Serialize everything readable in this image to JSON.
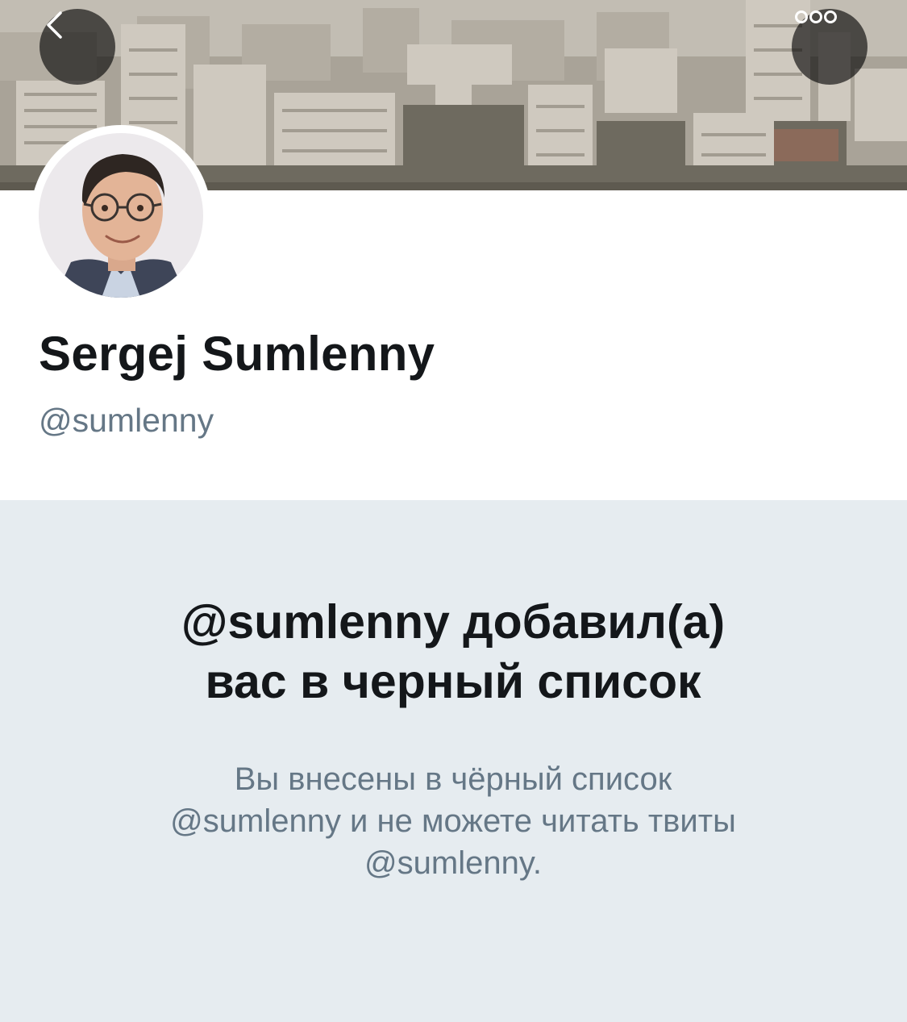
{
  "header": {
    "back_icon": "chevron-left-icon",
    "more_icon": "more-dots-icon"
  },
  "profile": {
    "display_name": "Sergej Sumlenny",
    "handle": "@sumlenny"
  },
  "blocked": {
    "title_line1": "@sumlenny добавил(а)",
    "title_line2": "вас в черный список",
    "message_line1": "Вы внесены в чёрный список",
    "message_line2": "@sumlenny и не можете читать твиты",
    "message_line3": "@sumlenny."
  },
  "colors": {
    "panel_bg": "#e6ecf0",
    "text_primary": "#14171a",
    "text_secondary": "#657786"
  }
}
